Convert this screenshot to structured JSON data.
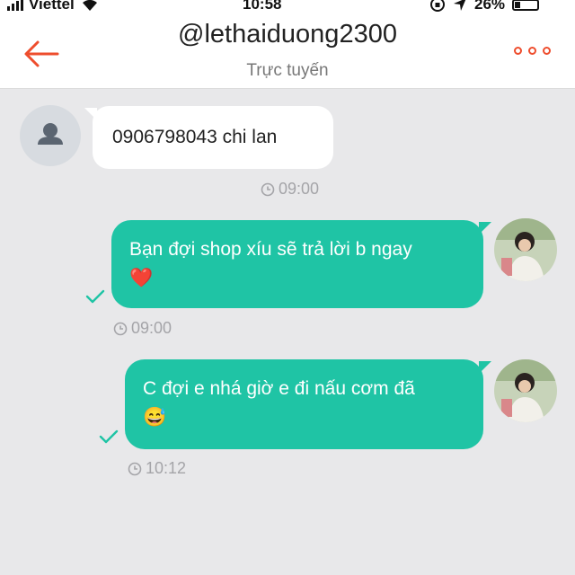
{
  "status_bar": {
    "carrier": "Viettel",
    "time": "10:58",
    "battery": "26%",
    "battery_level": 0.26
  },
  "header": {
    "title": "@lethaiduong2300",
    "subtitle": "Trực tuyến"
  },
  "messages": [
    {
      "direction": "incoming",
      "text": "0906798043 chi lan",
      "time": "09:00"
    },
    {
      "direction": "outgoing",
      "text": "Bạn đợi shop xíu sẽ trả lời b ngay",
      "emoji": "❤️",
      "time": "09:00",
      "read": true
    },
    {
      "direction": "outgoing",
      "text": "C đợi e nhá giờ e đi nấu cơm đã",
      "emoji": "😅",
      "time": "10:12",
      "read": true
    }
  ],
  "colors": {
    "accent": "#ee4d2d",
    "outgoing_bubble": "#1fc4a5",
    "incoming_bubble": "#ffffff",
    "background": "#e8e8ea"
  }
}
